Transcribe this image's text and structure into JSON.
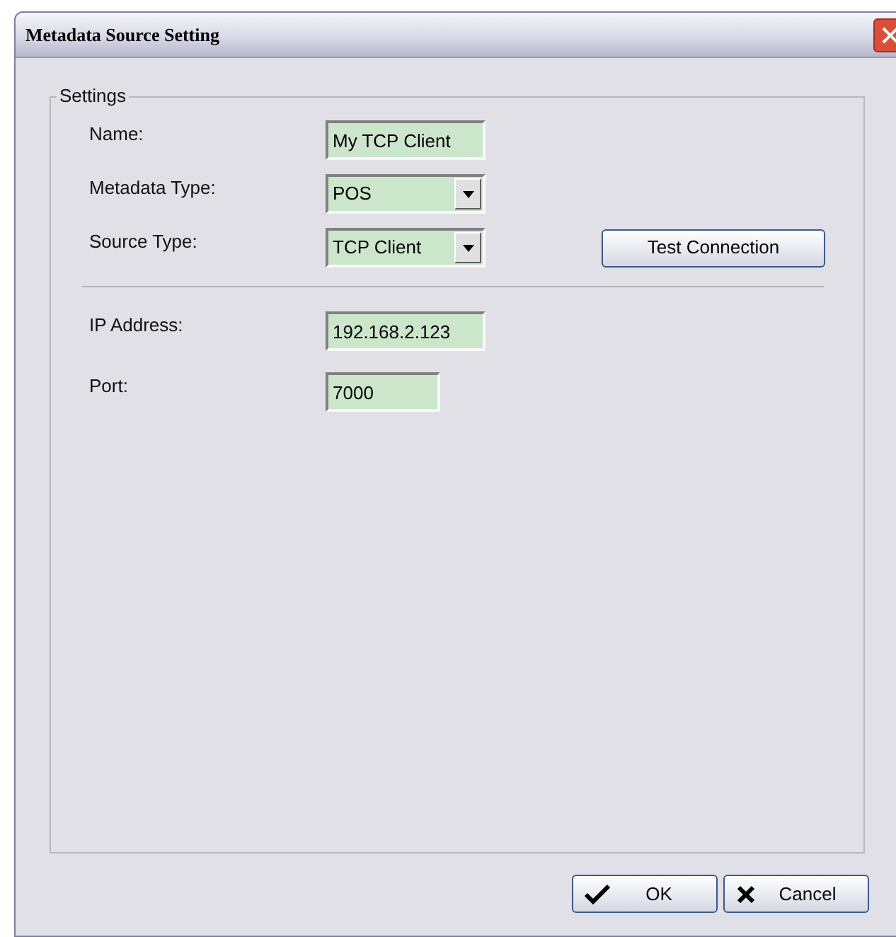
{
  "window": {
    "title": "Metadata Source Setting"
  },
  "group": {
    "title": "Settings"
  },
  "fields": [
    {
      "label": "Name:",
      "kind": "text",
      "value": "My TCP Client"
    },
    {
      "label": "Metadata Type:",
      "kind": "dropdown",
      "value": "POS"
    },
    {
      "label": "Source Type:",
      "kind": "dropdown",
      "value": "TCP Client"
    }
  ],
  "test_button": "Test Connection",
  "connection_fields": [
    {
      "label": "IP Address:",
      "kind": "text",
      "value": "192.168.2.123"
    },
    {
      "label": "Port:",
      "kind": "short",
      "value": "7000"
    }
  ],
  "buttons": [
    {
      "label": "OK",
      "kind": "ok"
    },
    {
      "label": "Cancel",
      "kind": "cancel"
    }
  ]
}
